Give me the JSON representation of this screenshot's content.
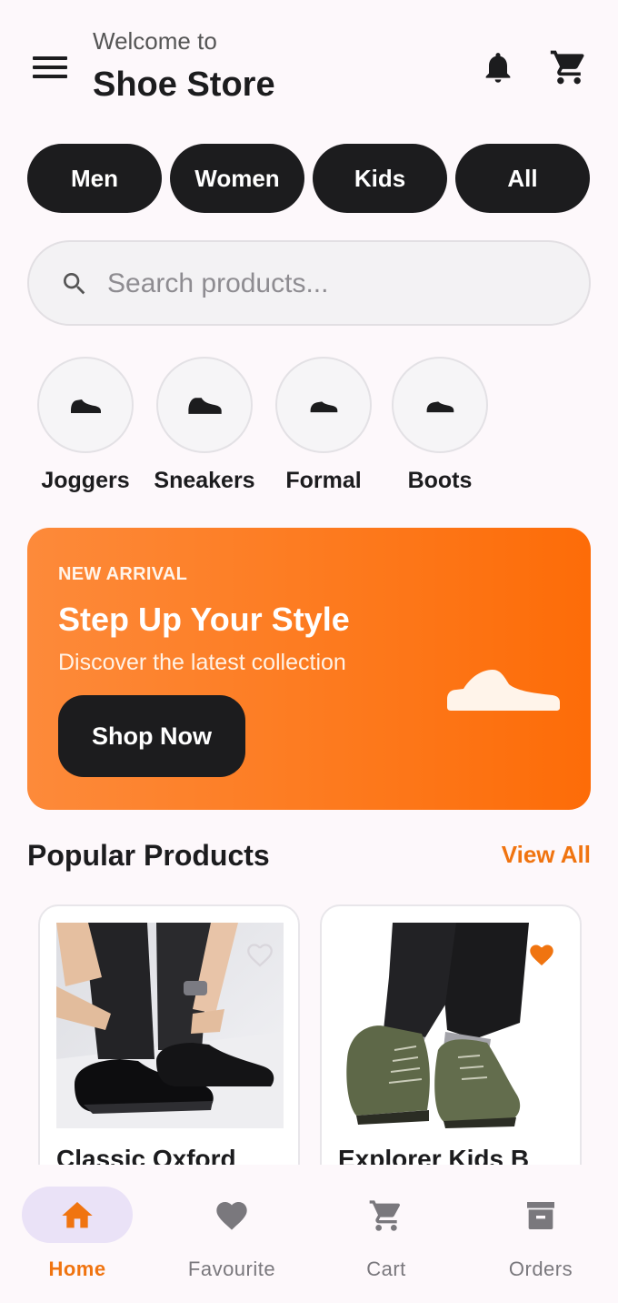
{
  "header": {
    "welcome": "Welcome to",
    "title": "Shoe Store"
  },
  "filters": [
    "Men",
    "Women",
    "Kids",
    "All"
  ],
  "search": {
    "placeholder": "Search products..."
  },
  "categories": [
    {
      "label": "Joggers",
      "icon": "shoe-icon"
    },
    {
      "label": "Sneakers",
      "icon": "shoe-icon"
    },
    {
      "label": "Formal",
      "icon": "shoe-icon"
    },
    {
      "label": "Boots",
      "icon": "shoe-icon"
    }
  ],
  "banner": {
    "tag": "NEW ARRIVAL",
    "title": "Step Up Your Style",
    "subtitle": "Discover the latest collection",
    "button": "Shop Now"
  },
  "popular": {
    "title": "Popular Products",
    "view_all": "View All",
    "products": [
      {
        "name": "Classic Oxford",
        "favourite": false
      },
      {
        "name": "Explorer Kids B",
        "favourite": true
      }
    ]
  },
  "bottom_nav": [
    {
      "label": "Home",
      "icon": "home-icon",
      "active": true
    },
    {
      "label": "Favourite",
      "icon": "heart-icon",
      "active": false
    },
    {
      "label": "Cart",
      "icon": "cart-icon",
      "active": false
    },
    {
      "label": "Orders",
      "icon": "archive-icon",
      "active": false
    }
  ],
  "colors": {
    "accent": "#f07410",
    "dark": "#1c1c1e",
    "banner_start": "#fd8a3a",
    "banner_end": "#fd6c08",
    "nav_active_bg": "#eae2f7",
    "background": "#fdf8fb"
  }
}
